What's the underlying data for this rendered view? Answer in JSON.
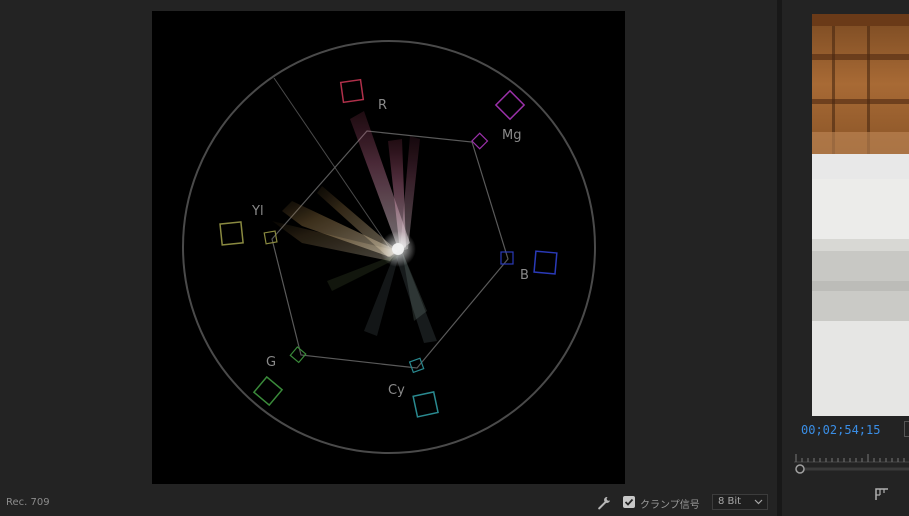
{
  "vectorscope": {
    "labels": {
      "r": "R",
      "mg": "Mg",
      "b": "B",
      "cy": "Cy",
      "g": "G",
      "yl": "Yl"
    },
    "colors": {
      "r": "#b0304a",
      "mg": "#9a30a8",
      "b": "#2a3ab8",
      "cy": "#2a8a90",
      "g": "#3a8a3a",
      "yl": "#8a8a40"
    }
  },
  "bottom_bar": {
    "colorspace": "Rec. 709",
    "clamp_label": "クランプ信号",
    "clamp_checked": true,
    "bit_depth": "8 Bit"
  },
  "preview": {
    "timecode": "00;02;54;15"
  },
  "icons": {
    "wrench": "wrench-icon",
    "checkbox": "checkbox-icon",
    "chevron": "chevron-down-icon",
    "playhead": "playhead-icon",
    "crop": "crop-marks-icon"
  }
}
